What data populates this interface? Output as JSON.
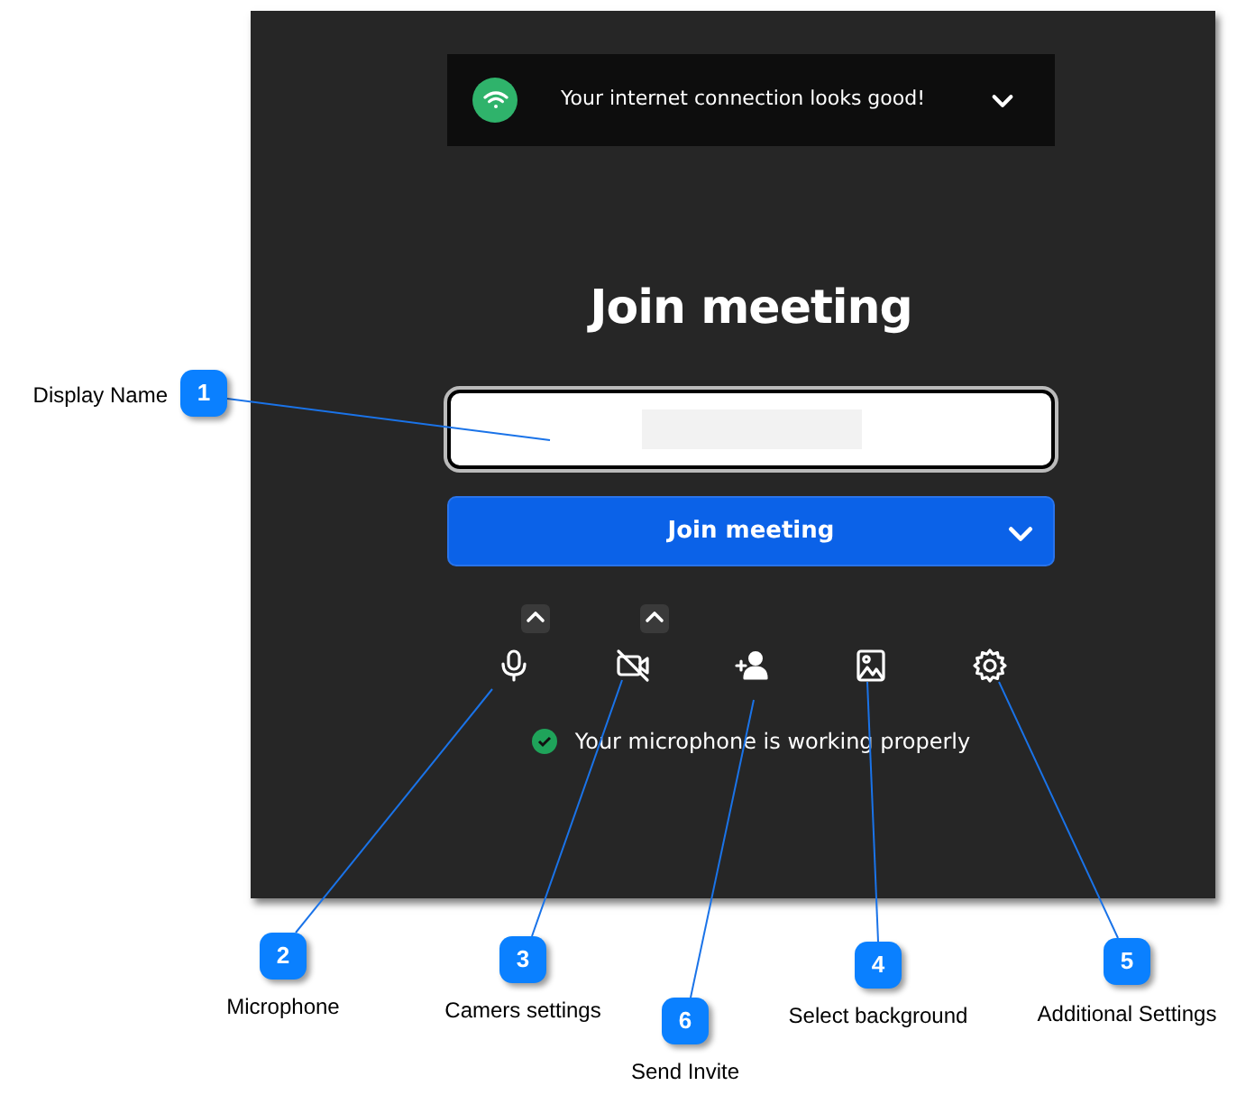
{
  "connection_banner": {
    "text": "Your internet connection looks good!",
    "expanded": false
  },
  "heading": "Join meeting",
  "display_name_field": {
    "redacted": true
  },
  "join_button": {
    "label": "Join meeting"
  },
  "toolbar": [
    {
      "kind": "microphone",
      "off": false,
      "has_menu": true
    },
    {
      "kind": "camera",
      "off": true,
      "has_menu": true
    },
    {
      "kind": "invite",
      "off": false,
      "has_menu": false
    },
    {
      "kind": "background",
      "off": false,
      "has_menu": false
    },
    {
      "kind": "settings",
      "off": false,
      "has_menu": false
    }
  ],
  "status_message": {
    "text": "Your microphone is working properly",
    "ok": true
  },
  "callouts": [
    {
      "number": "1",
      "label": "Display Name"
    },
    {
      "number": "2",
      "label": "Microphone"
    },
    {
      "number": "3",
      "label": "Camers settings"
    },
    {
      "number": "6",
      "label": "Send Invite"
    },
    {
      "number": "4",
      "label": "Select background"
    },
    {
      "number": "5",
      "label": "Additional Settings"
    }
  ]
}
